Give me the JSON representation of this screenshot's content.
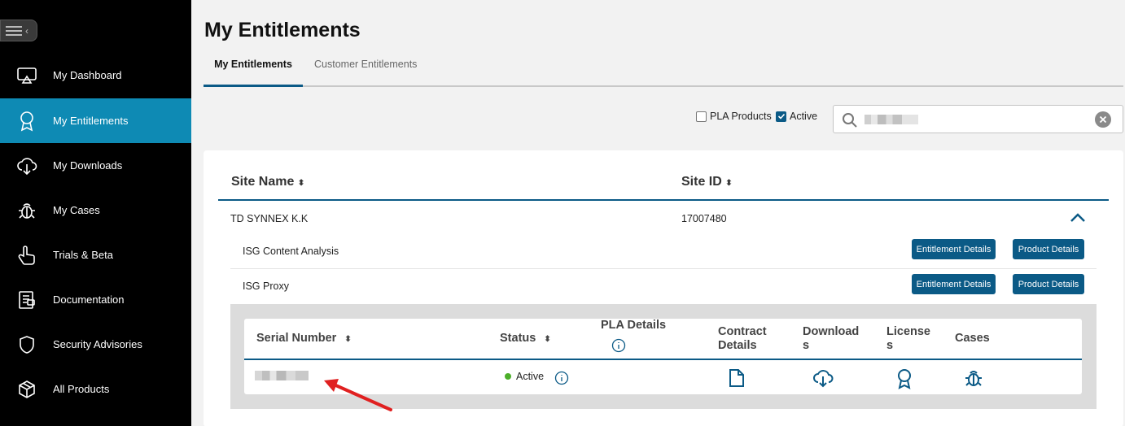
{
  "sidebar": {
    "items": [
      {
        "label": "My Dashboard",
        "icon": "monitor-icon"
      },
      {
        "label": "My Entitlements",
        "icon": "award-icon",
        "active": true
      },
      {
        "label": "My Downloads",
        "icon": "cloud-download-icon"
      },
      {
        "label": "My Cases",
        "icon": "bug-icon"
      },
      {
        "label": "Trials & Beta",
        "icon": "pointer-hand-icon"
      },
      {
        "label": "Documentation",
        "icon": "document-icon"
      },
      {
        "label": "Security Advisories",
        "icon": "shield-icon"
      },
      {
        "label": "All Products",
        "icon": "cube-icon"
      }
    ]
  },
  "header": {
    "title": "My Entitlements"
  },
  "tabs": [
    {
      "label": "My Entitlements",
      "active": true
    },
    {
      "label": "Customer Entitlements",
      "active": false
    }
  ],
  "filters": {
    "pla_label": "PLA Products",
    "pla_checked": false,
    "active_label": "Active",
    "active_checked": true
  },
  "search": {
    "value_redacted": true
  },
  "table": {
    "headers": {
      "site_name": "Site Name",
      "site_id": "Site ID"
    },
    "site": {
      "name": "TD SYNNEX K.K",
      "id": "17007480"
    },
    "products": [
      {
        "name": "ISG Content Analysis",
        "entitlement_btn": "Entitlement Details",
        "product_btn": "Product Details"
      },
      {
        "name": "ISG Proxy",
        "entitlement_btn": "Entitlement Details",
        "product_btn": "Product Details"
      }
    ],
    "detail": {
      "headers": {
        "serial": "Serial Number",
        "status": "Status",
        "pla": "PLA Details",
        "contract": "Contract Details",
        "downloads": "Downloads",
        "licenses": "Licenses",
        "cases": "Cases"
      },
      "row": {
        "status": "Active"
      }
    }
  },
  "colors": {
    "accent": "#0e8ab4",
    "primary": "#0b5a86",
    "active_dot": "#4caf2a",
    "annotation": "#e02020"
  }
}
